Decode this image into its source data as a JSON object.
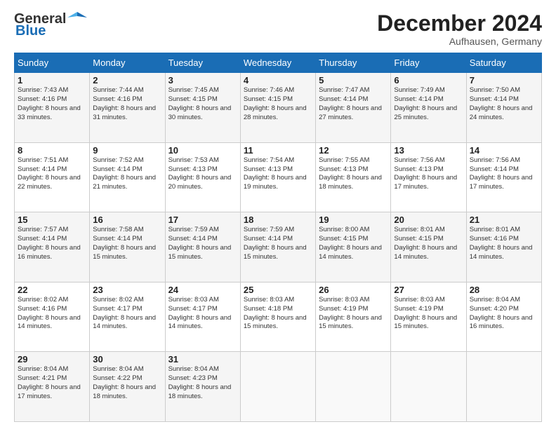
{
  "header": {
    "logo_line1": "General",
    "logo_line2": "Blue",
    "month": "December 2024",
    "location": "Aufhausen, Germany"
  },
  "weekdays": [
    "Sunday",
    "Monday",
    "Tuesday",
    "Wednesday",
    "Thursday",
    "Friday",
    "Saturday"
  ],
  "weeks": [
    [
      {
        "day": "1",
        "sunrise": "7:43 AM",
        "sunset": "4:16 PM",
        "daylight": "8 hours and 33 minutes."
      },
      {
        "day": "2",
        "sunrise": "7:44 AM",
        "sunset": "4:16 PM",
        "daylight": "8 hours and 31 minutes."
      },
      {
        "day": "3",
        "sunrise": "7:45 AM",
        "sunset": "4:15 PM",
        "daylight": "8 hours and 30 minutes."
      },
      {
        "day": "4",
        "sunrise": "7:46 AM",
        "sunset": "4:15 PM",
        "daylight": "8 hours and 28 minutes."
      },
      {
        "day": "5",
        "sunrise": "7:47 AM",
        "sunset": "4:14 PM",
        "daylight": "8 hours and 27 minutes."
      },
      {
        "day": "6",
        "sunrise": "7:49 AM",
        "sunset": "4:14 PM",
        "daylight": "8 hours and 25 minutes."
      },
      {
        "day": "7",
        "sunrise": "7:50 AM",
        "sunset": "4:14 PM",
        "daylight": "8 hours and 24 minutes."
      }
    ],
    [
      {
        "day": "8",
        "sunrise": "7:51 AM",
        "sunset": "4:14 PM",
        "daylight": "8 hours and 22 minutes."
      },
      {
        "day": "9",
        "sunrise": "7:52 AM",
        "sunset": "4:14 PM",
        "daylight": "8 hours and 21 minutes."
      },
      {
        "day": "10",
        "sunrise": "7:53 AM",
        "sunset": "4:13 PM",
        "daylight": "8 hours and 20 minutes."
      },
      {
        "day": "11",
        "sunrise": "7:54 AM",
        "sunset": "4:13 PM",
        "daylight": "8 hours and 19 minutes."
      },
      {
        "day": "12",
        "sunrise": "7:55 AM",
        "sunset": "4:13 PM",
        "daylight": "8 hours and 18 minutes."
      },
      {
        "day": "13",
        "sunrise": "7:56 AM",
        "sunset": "4:13 PM",
        "daylight": "8 hours and 17 minutes."
      },
      {
        "day": "14",
        "sunrise": "7:56 AM",
        "sunset": "4:14 PM",
        "daylight": "8 hours and 17 minutes."
      }
    ],
    [
      {
        "day": "15",
        "sunrise": "7:57 AM",
        "sunset": "4:14 PM",
        "daylight": "8 hours and 16 minutes."
      },
      {
        "day": "16",
        "sunrise": "7:58 AM",
        "sunset": "4:14 PM",
        "daylight": "8 hours and 15 minutes."
      },
      {
        "day": "17",
        "sunrise": "7:59 AM",
        "sunset": "4:14 PM",
        "daylight": "8 hours and 15 minutes."
      },
      {
        "day": "18",
        "sunrise": "7:59 AM",
        "sunset": "4:14 PM",
        "daylight": "8 hours and 15 minutes."
      },
      {
        "day": "19",
        "sunrise": "8:00 AM",
        "sunset": "4:15 PM",
        "daylight": "8 hours and 14 minutes."
      },
      {
        "day": "20",
        "sunrise": "8:01 AM",
        "sunset": "4:15 PM",
        "daylight": "8 hours and 14 minutes."
      },
      {
        "day": "21",
        "sunrise": "8:01 AM",
        "sunset": "4:16 PM",
        "daylight": "8 hours and 14 minutes."
      }
    ],
    [
      {
        "day": "22",
        "sunrise": "8:02 AM",
        "sunset": "4:16 PM",
        "daylight": "8 hours and 14 minutes."
      },
      {
        "day": "23",
        "sunrise": "8:02 AM",
        "sunset": "4:17 PM",
        "daylight": "8 hours and 14 minutes."
      },
      {
        "day": "24",
        "sunrise": "8:03 AM",
        "sunset": "4:17 PM",
        "daylight": "8 hours and 14 minutes."
      },
      {
        "day": "25",
        "sunrise": "8:03 AM",
        "sunset": "4:18 PM",
        "daylight": "8 hours and 15 minutes."
      },
      {
        "day": "26",
        "sunrise": "8:03 AM",
        "sunset": "4:19 PM",
        "daylight": "8 hours and 15 minutes."
      },
      {
        "day": "27",
        "sunrise": "8:03 AM",
        "sunset": "4:19 PM",
        "daylight": "8 hours and 15 minutes."
      },
      {
        "day": "28",
        "sunrise": "8:04 AM",
        "sunset": "4:20 PM",
        "daylight": "8 hours and 16 minutes."
      }
    ],
    [
      {
        "day": "29",
        "sunrise": "8:04 AM",
        "sunset": "4:21 PM",
        "daylight": "8 hours and 17 minutes."
      },
      {
        "day": "30",
        "sunrise": "8:04 AM",
        "sunset": "4:22 PM",
        "daylight": "8 hours and 18 minutes."
      },
      {
        "day": "31",
        "sunrise": "8:04 AM",
        "sunset": "4:23 PM",
        "daylight": "8 hours and 18 minutes."
      },
      null,
      null,
      null,
      null
    ]
  ]
}
